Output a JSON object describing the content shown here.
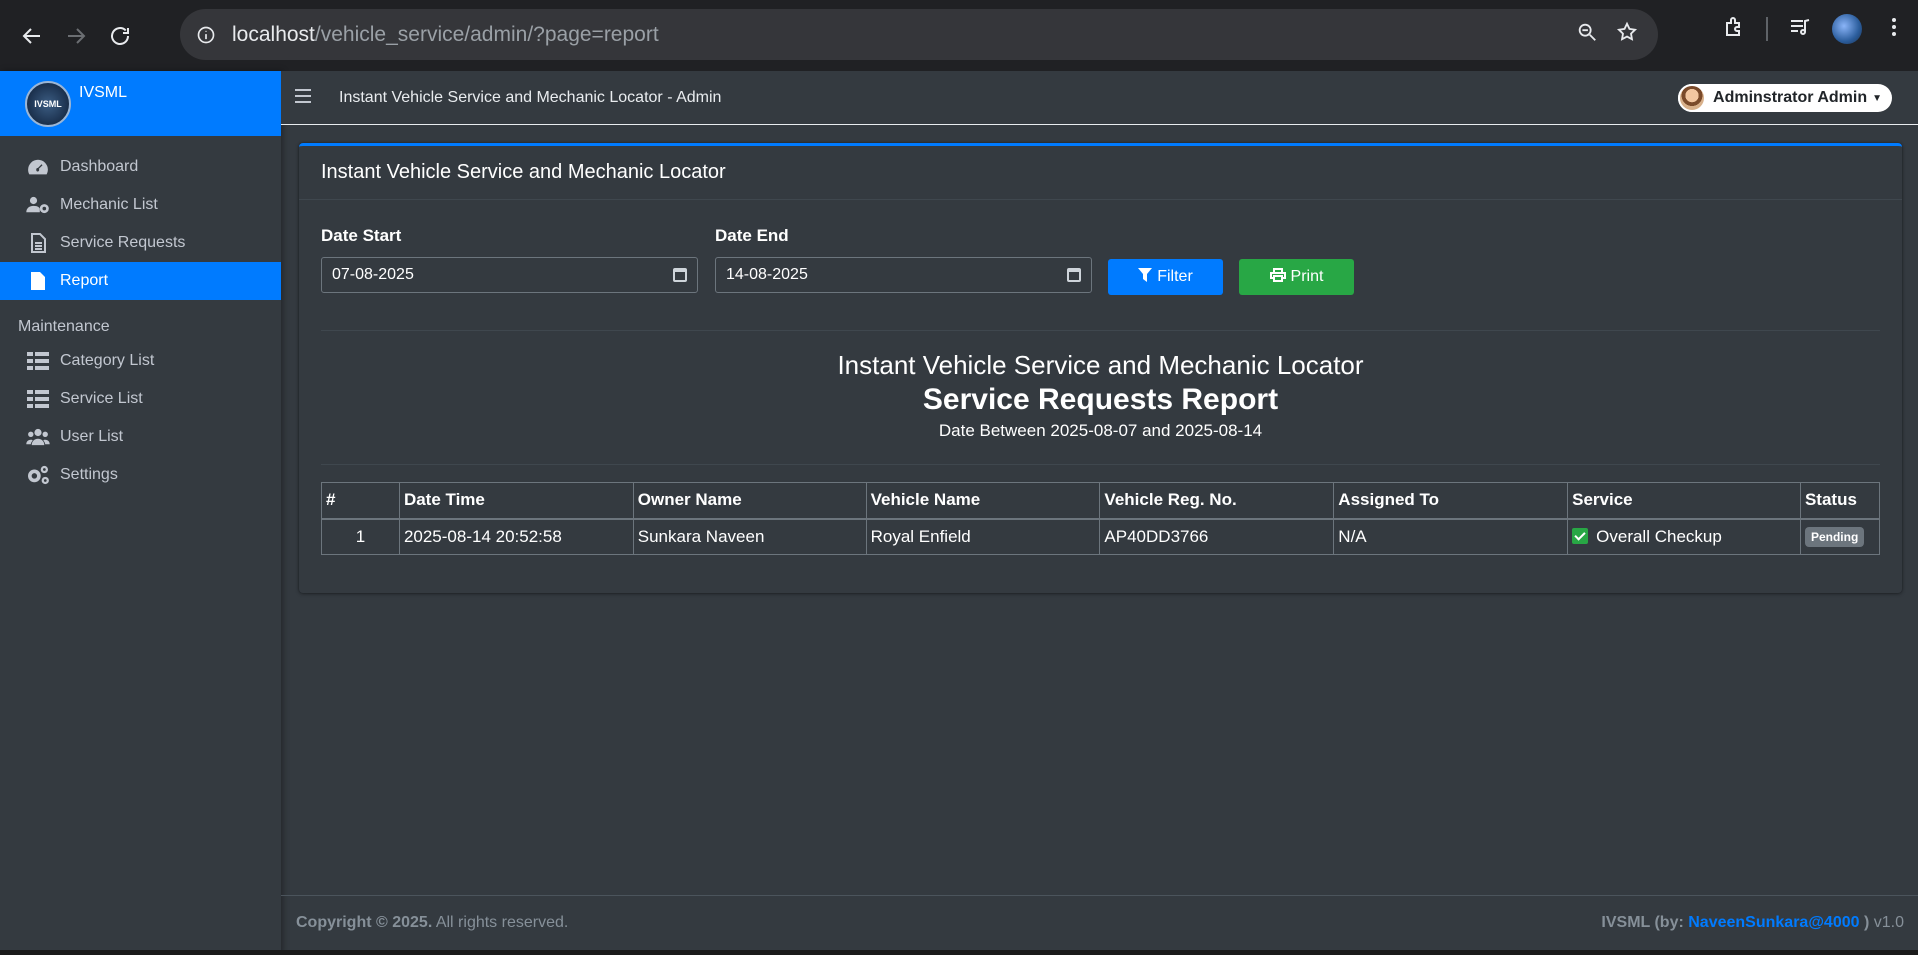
{
  "browser": {
    "url_host": "localhost",
    "url_path": "/vehicle_service/admin/?page=report"
  },
  "brand": {
    "logo_text": "IVSML",
    "name": "IVSML"
  },
  "sidebar": {
    "items": [
      {
        "label": "Dashboard",
        "icon": "tachometer-icon"
      },
      {
        "label": "Mechanic List",
        "icon": "users-cog-icon"
      },
      {
        "label": "Service Requests",
        "icon": "file-lines-icon"
      },
      {
        "label": "Report",
        "icon": "file-icon",
        "active": true
      }
    ],
    "section_header": "Maintenance",
    "maintenance_items": [
      {
        "label": "Category List",
        "icon": "table-icon"
      },
      {
        "label": "Service List",
        "icon": "table-icon"
      },
      {
        "label": "User List",
        "icon": "users-icon"
      },
      {
        "label": "Settings",
        "icon": "cogs-icon"
      }
    ]
  },
  "topbar": {
    "title": "Instant Vehicle Service and Mechanic Locator - Admin",
    "user_name": "Adminstrator Admin"
  },
  "card": {
    "header": "Instant Vehicle Service and Mechanic Locator",
    "date_start_label": "Date Start",
    "date_start_value": "07-08-2025",
    "date_end_label": "Date End",
    "date_end_value": "14-08-2025",
    "filter_label": "Filter",
    "print_label": "Print"
  },
  "report": {
    "title": "Instant Vehicle Service and Mechanic Locator",
    "subtitle": "Service Requests Report",
    "range": "Date Between 2025-08-07 and 2025-08-14"
  },
  "table": {
    "headers": [
      "#",
      "Date Time",
      "Owner Name",
      "Vehicle Name",
      "Vehicle Reg. No.",
      "Assigned To",
      "Service",
      "Status"
    ],
    "rows": [
      {
        "num": "1",
        "datetime": "2025-08-14 20:52:58",
        "owner": "Sunkara Naveen",
        "vehicle": "Royal Enfield",
        "reg": "AP40DD3766",
        "assigned": "N/A",
        "service": "Overall Checkup",
        "status": "Pending"
      }
    ]
  },
  "footer": {
    "copyright_bold": "Copyright © 2025.",
    "copyright_rest": "All rights reserved.",
    "credit_bold": "IVSML (by:",
    "credit_link": "NaveenSunkara@4000",
    "credit_close": ")",
    "version": "v1.0"
  },
  "colors": {
    "primary": "#007bff",
    "success": "#28a745",
    "background": "#343a40",
    "badge": "#6c757d"
  }
}
